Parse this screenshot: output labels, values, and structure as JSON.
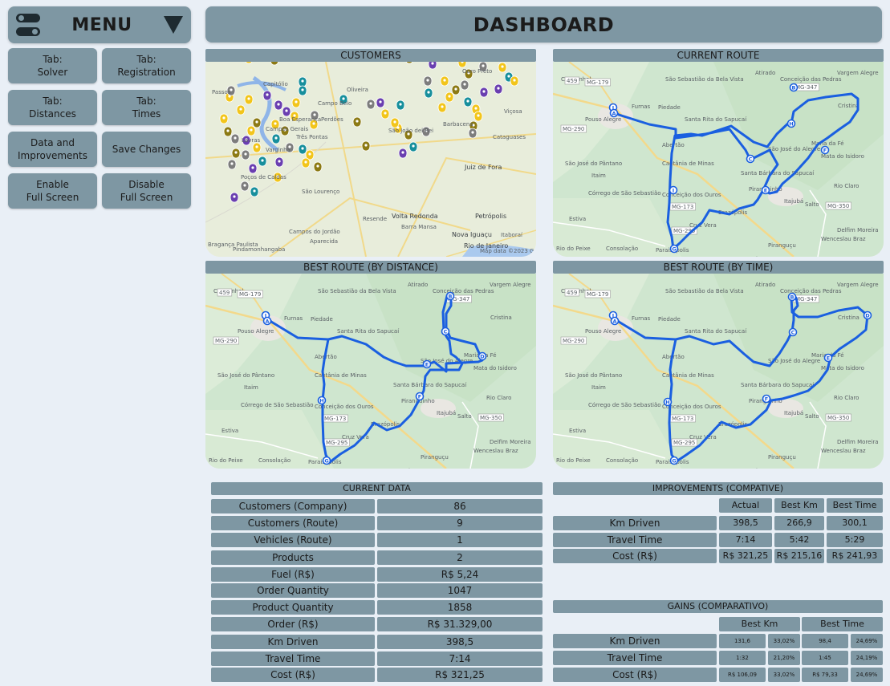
{
  "menu": {
    "label": "MENU"
  },
  "buttons": {
    "solver": "Tab:\nSolver",
    "registration": "Tab:\nRegistration",
    "distances": "Tab:\nDistances",
    "times": "Tab:\nTimes",
    "data_improvements": "Data and\nImprovements",
    "save_changes": "Save Changes",
    "enable_fullscreen": "Enable\nFull Screen",
    "disable_fullscreen": "Disable\nFull Screen"
  },
  "dashboard": {
    "title": "DASHBOARD"
  },
  "panels": {
    "customers": "CUSTOMERS",
    "current_route": "CURRENT ROUTE",
    "best_distance": "BEST ROUTE (BY DISTANCE)",
    "best_time": "BEST ROUTE (BY TIME)"
  },
  "map_labels": {
    "customers": [
      "Capitólio",
      "Passos",
      "Oliveira",
      "Ouro Preto",
      "Campo Belo",
      "Boa Esperança",
      "Perdões",
      "Campos Gerais",
      "Três Pontas",
      "Lavras",
      "Varginha",
      "São João del Rei",
      "Barbacena",
      "Viçosa",
      "Poços de Caldas",
      "Juiz de Fora",
      "São Lourenço",
      "Cataguases",
      "Volta Redonda",
      "Petrópolis",
      "Resende",
      "Barra Mansa",
      "Nova Iguaçu",
      "Itaboraí",
      "Rio de Janeiro",
      "Bragança Paulista",
      "Pindamonhangaba",
      "Aparecida",
      "Campos do Jordão",
      "Map data ©2023 Google"
    ],
    "route": [
      "Congonhal",
      "São Sebastião da Bela Vista",
      "Atirado",
      "Conceição das Pedras",
      "Vargem Alegre",
      "Furnas",
      "Pouso Alegre",
      "Piedade",
      "Santa Rita do Sapucaí",
      "Cristina",
      "Abertão",
      "Caetânia de Minas",
      "São José do Alegre",
      "Maria da Fé",
      "Mata do Isidoro",
      "São José do Pântano",
      "Itaim",
      "Santa Bárbara do Sapucaí",
      "Piranguinho",
      "Rio Claro",
      "Córrego de São Sebastião",
      "Conceição dos Ouros",
      "Itajubá",
      "Salto",
      "Estiva",
      "Brazópolis",
      "Cruz Vera",
      "Delfim Moreira",
      "Rio do Peixe",
      "Consolação",
      "Paraisópolis",
      "Piranguçu",
      "Wenceslau Braz",
      "Rio Vermelho",
      "Luminosa"
    ],
    "roads": [
      "MG-179",
      "MG-290",
      "MG-173",
      "MG-295",
      "MG-347",
      "MG-350",
      "459"
    ]
  },
  "current_data": {
    "title": "CURRENT DATA",
    "rows": [
      {
        "label": "Customers (Company)",
        "value": "86"
      },
      {
        "label": "Customers (Route)",
        "value": "9"
      },
      {
        "label": "Vehicles (Route)",
        "value": "1"
      },
      {
        "label": "Products",
        "value": "2"
      },
      {
        "label": "Fuel (R$)",
        "value": "R$ 5,24"
      },
      {
        "label": "Order Quantity",
        "value": "1047"
      },
      {
        "label": "Product Quantity",
        "value": "1858"
      },
      {
        "label": "Order (R$)",
        "value": "R$ 31.329,00"
      },
      {
        "label": "Km Driven",
        "value": "398,5"
      },
      {
        "label": "Travel Time",
        "value": "7:14"
      },
      {
        "label": "Cost (R$)",
        "value": "R$ 321,25"
      }
    ]
  },
  "improvements": {
    "title": "IMPROVEMENTS (COMPATIVE)",
    "headers": [
      "Actual",
      "Best Km",
      "Best Time"
    ],
    "rows": [
      {
        "label": "Km Driven",
        "values": [
          "398,5",
          "266,9",
          "300,1"
        ]
      },
      {
        "label": "Travel Time",
        "values": [
          "7:14",
          "5:42",
          "5:29"
        ]
      },
      {
        "label": "Cost (R$)",
        "values": [
          "R$ 321,25",
          "R$ 215,16",
          "R$ 241,93"
        ]
      }
    ]
  },
  "gains": {
    "title": "GAINS (COMPARATIVO)",
    "headers": [
      "Best Km",
      "Best Time"
    ],
    "rows": [
      {
        "label": "Km Driven",
        "values": [
          "131,6",
          "33,02%",
          "98,4",
          "24,69%"
        ]
      },
      {
        "label": "Travel Time",
        "values": [
          "1:32",
          "21,20%",
          "1:45",
          "24,19%"
        ]
      },
      {
        "label": "Cost (R$)",
        "values": [
          "R$ 106,09",
          "33,02%",
          "R$ 79,33",
          "24,69%"
        ]
      }
    ]
  },
  "colors": {
    "bar": "#7e97a3",
    "background": "#e9eff6",
    "route": "#1a5fe0"
  }
}
